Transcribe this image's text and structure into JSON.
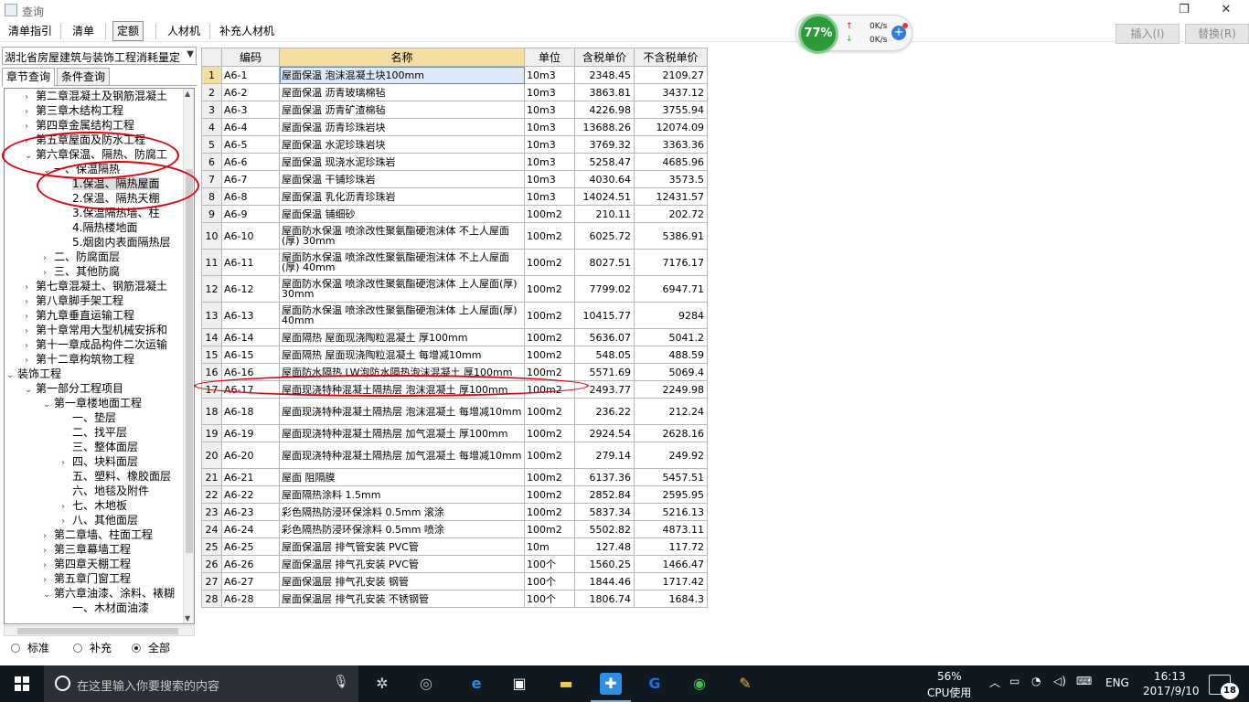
{
  "window": {
    "title": "查询",
    "restore_glyph": "❐",
    "close_glyph": "✕"
  },
  "toolbar": {
    "buttons": [
      "清单指引",
      "清单",
      "定额",
      "人材机",
      "补充人材机"
    ],
    "active_index": 2,
    "insert_label": "插入(I)",
    "replace_label": "替换(R)"
  },
  "network": {
    "percent": "77%",
    "up": "0K/s",
    "down": "0K/s"
  },
  "left": {
    "library": "湖北省房屋建筑与装饰工程消耗量定",
    "tabs": [
      "章节查询",
      "条件查询"
    ],
    "tree": [
      {
        "label": "第二章混凝土及钢筋混凝土",
        "level": 2,
        "toggle": ">"
      },
      {
        "label": "第三章木结构工程",
        "level": 2,
        "toggle": ">"
      },
      {
        "label": "第四章金属结构工程",
        "level": 2,
        "toggle": ">"
      },
      {
        "label": "第五章屋面及防水工程",
        "level": 2,
        "toggle": ">"
      },
      {
        "label": "第六章保温、隔热、防腐工",
        "level": 2,
        "toggle": "v"
      },
      {
        "label": "一、保温隔热",
        "level": 3,
        "toggle": "v"
      },
      {
        "label": "1.保温、隔热屋面",
        "level": 4,
        "toggle": "",
        "selected": true
      },
      {
        "label": "2.保温、隔热天棚",
        "level": 4,
        "toggle": ""
      },
      {
        "label": "3.保温隔热墙、柱",
        "level": 4,
        "toggle": ""
      },
      {
        "label": "4.隔热楼地面",
        "level": 4,
        "toggle": ""
      },
      {
        "label": "5.烟囱内表面隔热层",
        "level": 4,
        "toggle": ""
      },
      {
        "label": "二、防腐面层",
        "level": 3,
        "toggle": ">"
      },
      {
        "label": "三、其他防腐",
        "level": 3,
        "toggle": ">"
      },
      {
        "label": "第七章混凝土、钢筋混凝土",
        "level": 2,
        "toggle": ">"
      },
      {
        "label": "第八章脚手架工程",
        "level": 2,
        "toggle": ">"
      },
      {
        "label": "第九章垂直运输工程",
        "level": 2,
        "toggle": ">"
      },
      {
        "label": "第十章常用大型机械安拆和",
        "level": 2,
        "toggle": ">"
      },
      {
        "label": "第十一章成品构件二次运输",
        "level": 2,
        "toggle": ">"
      },
      {
        "label": "第十二章构筑物工程",
        "level": 2,
        "toggle": ">"
      },
      {
        "label": "装饰工程",
        "level": 1,
        "toggle": "v"
      },
      {
        "label": "第一部分工程项目",
        "level": 2,
        "toggle": "v"
      },
      {
        "label": "第一章楼地面工程",
        "level": 3,
        "toggle": "v"
      },
      {
        "label": "一、垫层",
        "level": 4,
        "toggle": ""
      },
      {
        "label": "二、找平层",
        "level": 4,
        "toggle": ""
      },
      {
        "label": "三、整体面层",
        "level": 4,
        "toggle": ""
      },
      {
        "label": "四、块料面层",
        "level": 4,
        "toggle": ">"
      },
      {
        "label": "五、塑料、橡胶面层",
        "level": 4,
        "toggle": ""
      },
      {
        "label": "六、地毯及附件",
        "level": 4,
        "toggle": ""
      },
      {
        "label": "七、木地板",
        "level": 4,
        "toggle": ">"
      },
      {
        "label": "八、其他面层",
        "level": 4,
        "toggle": ">"
      },
      {
        "label": "第二章墙、柱面工程",
        "level": 3,
        "toggle": ">"
      },
      {
        "label": "第三章幕墙工程",
        "level": 3,
        "toggle": ">"
      },
      {
        "label": "第四章天棚工程",
        "level": 3,
        "toggle": ">"
      },
      {
        "label": "第五章门窗工程",
        "level": 3,
        "toggle": ">"
      },
      {
        "label": "第六章油漆、涂料、裱糊",
        "level": 3,
        "toggle": "v"
      },
      {
        "label": "一、木材面油漆",
        "level": 4,
        "toggle": ""
      }
    ],
    "radios": [
      {
        "label": "标准",
        "on": false
      },
      {
        "label": "补充",
        "on": false
      },
      {
        "label": "全部",
        "on": true
      }
    ]
  },
  "grid": {
    "headers": [
      "",
      "编码",
      "名称",
      "单位",
      "含税单价",
      "不含税单价"
    ],
    "rows": [
      [
        "1",
        "A6-1",
        "屋面保温 泡沫混凝土块100mm",
        "10m3",
        "2348.45",
        "2109.27"
      ],
      [
        "2",
        "A6-2",
        "屋面保温 沥青玻璃棉毡",
        "10m3",
        "3863.81",
        "3437.12"
      ],
      [
        "3",
        "A6-3",
        "屋面保温 沥青矿渣棉毡",
        "10m3",
        "4226.98",
        "3755.94"
      ],
      [
        "4",
        "A6-4",
        "屋面保温 沥青珍珠岩块",
        "10m3",
        "13688.26",
        "12074.09"
      ],
      [
        "5",
        "A6-5",
        "屋面保温 水泥珍珠岩块",
        "10m3",
        "3769.32",
        "3363.36"
      ],
      [
        "6",
        "A6-6",
        "屋面保温 现浇水泥珍珠岩",
        "10m3",
        "5258.47",
        "4685.96"
      ],
      [
        "7",
        "A6-7",
        "屋面保温 干铺珍珠岩",
        "10m3",
        "4030.64",
        "3573.5"
      ],
      [
        "8",
        "A6-8",
        "屋面保温 乳化沥青珍珠岩",
        "10m3",
        "14024.51",
        "12431.57"
      ],
      [
        "9",
        "A6-9",
        "屋面保温 铺细砂",
        "100m2",
        "210.11",
        "202.72"
      ],
      [
        "10",
        "A6-10",
        "屋面防水保温 喷涂改性聚氨酯硬泡沫体 不上人屋面(厚) 30mm",
        "100m2",
        "6025.72",
        "5386.91"
      ],
      [
        "11",
        "A6-11",
        "屋面防水保温 喷涂改性聚氨酯硬泡沫体 不上人屋面(厚) 40mm",
        "100m2",
        "8027.51",
        "7176.17"
      ],
      [
        "12",
        "A6-12",
        "屋面防水保温 喷涂改性聚氨酯硬泡沫体 上人屋面(厚) 30mm",
        "100m2",
        "7799.02",
        "6947.71"
      ],
      [
        "13",
        "A6-13",
        "屋面防水保温 喷涂改性聚氨酯硬泡沫体 上人屋面(厚) 40mm",
        "100m2",
        "10415.77",
        "9284"
      ],
      [
        "14",
        "A6-14",
        "屋面隔热 屋面现浇陶粒混凝土 厚100mm",
        "100m2",
        "5636.07",
        "5041.2"
      ],
      [
        "15",
        "A6-15",
        "屋面隔热 屋面现浇陶粒混凝土 每增减10mm",
        "100m2",
        "548.05",
        "488.59"
      ],
      [
        "16",
        "A6-16",
        "屋面防水隔热 LW泡防水隔热泡沫混凝土 厚100mm",
        "100m2",
        "5571.69",
        "5069.4"
      ],
      [
        "17",
        "A6-17",
        "屋面现浇特种混凝土隔热层 泡沫混凝土 厚100mm",
        "100m2",
        "2493.77",
        "2249.98"
      ],
      [
        "18",
        "A6-18",
        "屋面现浇特种混凝土隔热层 泡沫混凝土 每增减10mm",
        "100m2",
        "236.22",
        "212.24"
      ],
      [
        "19",
        "A6-19",
        "屋面现浇特种混凝土隔热层 加气混凝土 厚100mm",
        "100m2",
        "2924.54",
        "2628.16"
      ],
      [
        "20",
        "A6-20",
        "屋面现浇特种混凝土隔热层 加气混凝土 每增减10mm",
        "100m2",
        "279.14",
        "249.92"
      ],
      [
        "21",
        "A6-21",
        "屋面 阻隔膜",
        "100m2",
        "6137.36",
        "5457.51"
      ],
      [
        "22",
        "A6-22",
        "屋面隔热涂料 1.5mm",
        "100m2",
        "2852.84",
        "2595.95"
      ],
      [
        "23",
        "A6-23",
        "彩色隔热防浸环保涂料 0.5mm 滚涂",
        "100m2",
        "5837.34",
        "5216.13"
      ],
      [
        "24",
        "A6-24",
        "彩色隔热防浸环保涂料 0.5mm 喷涂",
        "100m2",
        "5502.82",
        "4873.11"
      ],
      [
        "25",
        "A6-25",
        "屋面保温层 排气管安装 PVC管",
        "10m",
        "127.48",
        "117.72"
      ],
      [
        "26",
        "A6-26",
        "屋面保温层 排气孔安装 PVC管",
        "100个",
        "1560.25",
        "1466.47"
      ],
      [
        "27",
        "A6-27",
        "屋面保温层 排气孔安装 钢管",
        "100个",
        "1844.46",
        "1717.42"
      ],
      [
        "28",
        "A6-28",
        "屋面保温层 排气孔安装 不锈钢管",
        "100个",
        "1806.74",
        "1684.3"
      ]
    ],
    "two_line_rows": [
      10,
      11,
      12,
      13,
      18,
      20
    ]
  },
  "taskbar": {
    "search_placeholder": "在这里输入你要搜索的内容",
    "cpu_percent": "56%",
    "cpu_label": "CPU使用",
    "lang": "ENG",
    "time": "16:13",
    "date": "2017/9/10",
    "notifications": "18"
  }
}
